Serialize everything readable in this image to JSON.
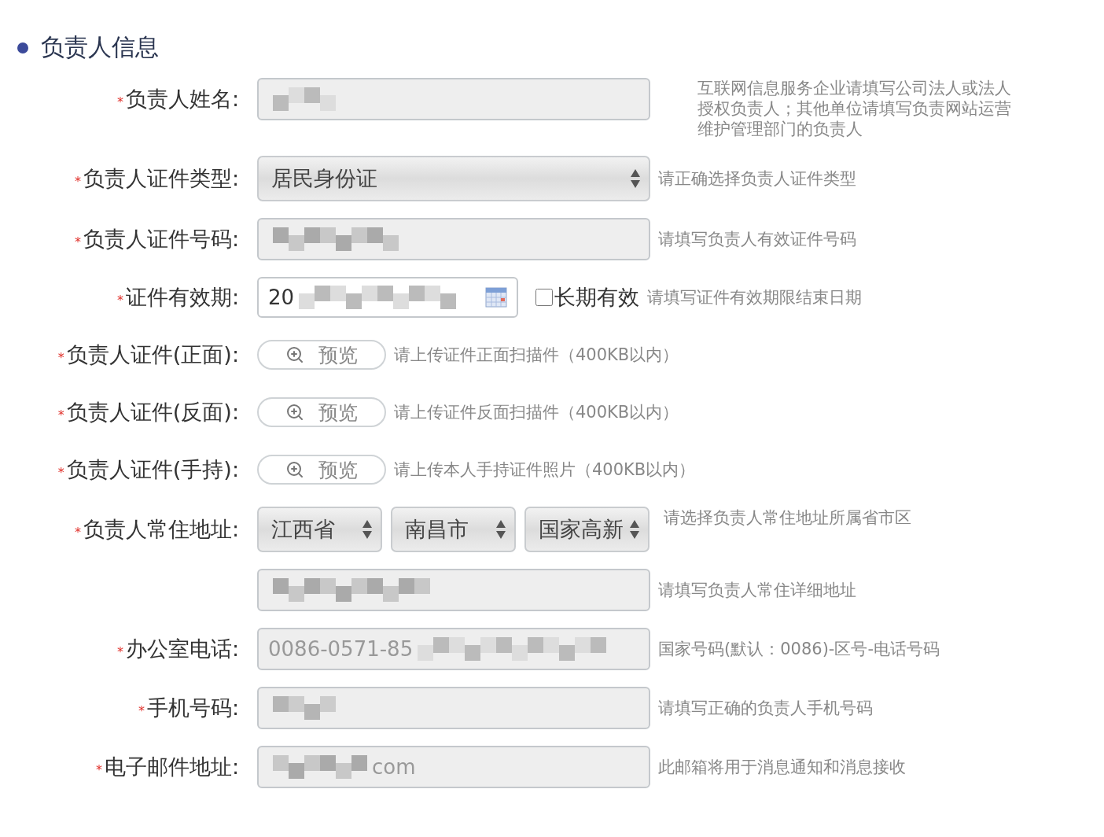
{
  "section": {
    "title": "负责人信息"
  },
  "rows": [
    {
      "kind": "text",
      "mark": "*",
      "label": "负责人姓名:",
      "value": "",
      "redacted": true,
      "disabled": true,
      "hint_lines": [
        "互联网信息服务企业请填写公司法人或法人",
        "授权负责人；其他单位请填写负责网站运营",
        "维护管理部门的负责人"
      ]
    },
    {
      "kind": "select",
      "mark": "*",
      "label": "负责人证件类型:",
      "options": [
        {
          "value": "居民身份证"
        }
      ],
      "hint": "请正确选择负责人证件类型"
    },
    {
      "kind": "text",
      "mark": "*",
      "label": "负责人证件号码:",
      "redacted": true,
      "disabled": true,
      "hint": "请填写负责人有效证件号码"
    },
    {
      "kind": "date",
      "mark": "*",
      "label": "证件有效期:",
      "value": "20",
      "redacted": true,
      "checkbox": {
        "label": "长期有效",
        "checked": false
      },
      "hint": "请填写证件有效期限结束日期"
    },
    {
      "kind": "upload",
      "mark": "*",
      "label": "负责人证件(正面):",
      "button": "预览",
      "hint": "请上传证件正面扫描件（400KB以内）"
    },
    {
      "kind": "upload",
      "mark": "*",
      "label": "负责人证件(反面):",
      "button": "预览",
      "hint": "请上传证件反面扫描件（400KB以内）"
    },
    {
      "kind": "upload",
      "mark": "*",
      "label": "负责人证件(手持):",
      "button": "预览",
      "hint": "请上传本人手持证件照片（400KB以内）"
    },
    {
      "kind": "select",
      "mark": "*",
      "label": "负责人常住地址:",
      "options": [
        {
          "value": "江西省"
        },
        {
          "value": "南昌市"
        },
        {
          "value": "国家高新"
        }
      ],
      "hint": "请选择负责人常住地址所属省市区"
    },
    {
      "kind": "text",
      "redacted": true,
      "disabled": true,
      "hint": "请填写负责人常住详细地址"
    },
    {
      "kind": "text",
      "mark": "*",
      "label": "办公室电话:",
      "value": "0086-0571-85",
      "redacted": true,
      "disabled": true,
      "hint": "国家号码(默认：0086)-区号-电话号码"
    },
    {
      "kind": "text",
      "mark": "*",
      "label": "手机号码:",
      "redacted": true,
      "disabled": true,
      "hint": "请填写正确的负责人手机号码"
    },
    {
      "kind": "text",
      "mark": "*",
      "label": "电子邮件地址:",
      "value": "com",
      "redacted": true,
      "value_after": true,
      "disabled": true,
      "hint": "此邮箱将用于消息通知和消息接收"
    }
  ]
}
